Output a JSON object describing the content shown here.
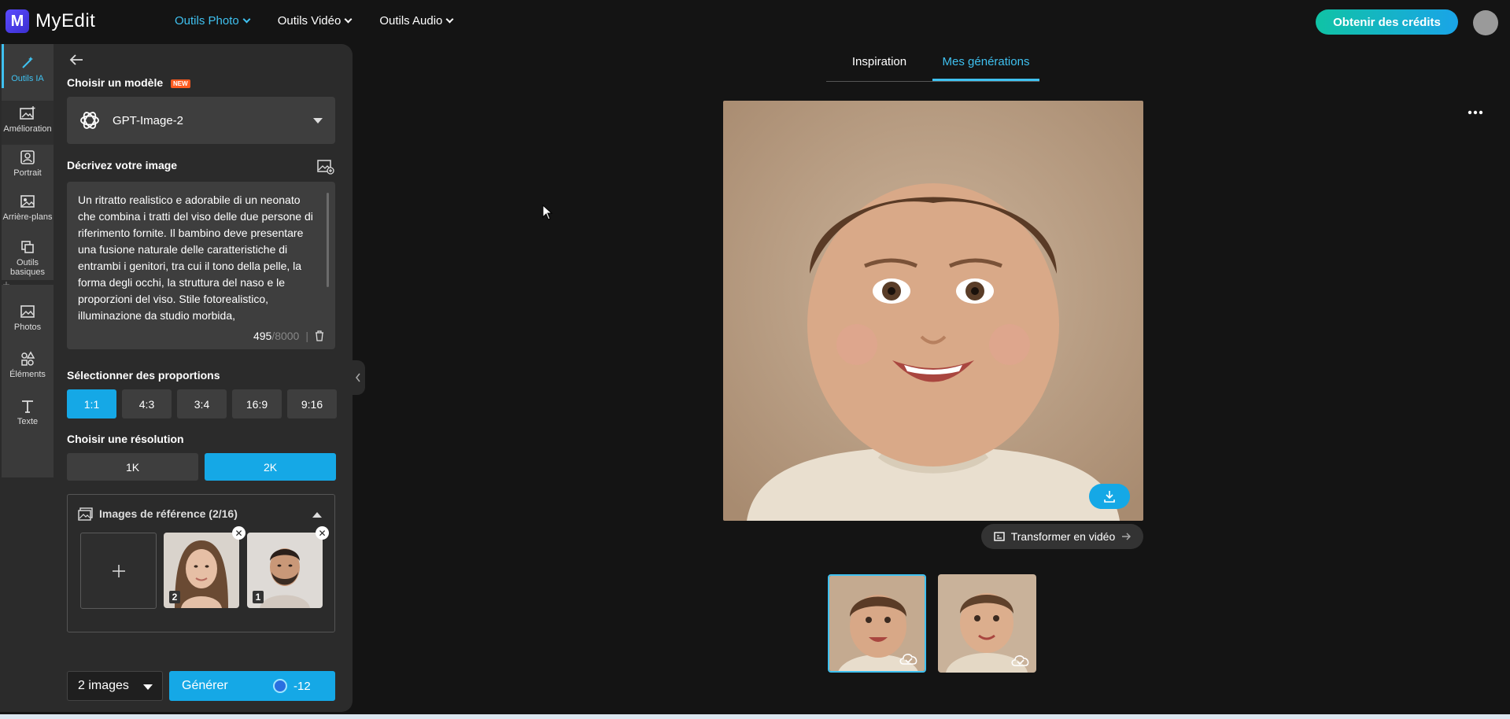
{
  "brand": {
    "name": "MyEdit",
    "mark": "M"
  },
  "nav": {
    "photo_tools": "Outils Photo",
    "video_tools": "Outils Vidéo",
    "audio_tools": "Outils Audio"
  },
  "header": {
    "credits_button": "Obtenir des crédits"
  },
  "rail": {
    "ai_tools": "Outils IA",
    "enhance": "Amélioration",
    "portrait": "Portrait",
    "backgrounds": "Arrière-plans",
    "basic_tools": "Outils basiques",
    "photos": "Photos",
    "elements": "Éléments",
    "text": "Texte"
  },
  "panel": {
    "model_label": "Choisir un modèle",
    "new_badge": "NEW",
    "model_value": "GPT-Image-2",
    "describe_label": "Décrivez votre image",
    "prompt": "Un ritratto realistico e adorabile di un neonato che combina i tratti del viso delle due persone di riferimento fornite. Il bambino deve presentare una fusione naturale delle caratteristiche di entrambi i genitori, tra cui il tono della pelle, la forma degli occhi, la struttura del naso e le proporzioni del viso. Stile fotorealistico, illuminazione da studio morbida,",
    "char_count": "495",
    "char_max": "/8000",
    "ratio_label": "Sélectionner des proportions",
    "ratios": [
      "1:1",
      "4:3",
      "3:4",
      "16:9",
      "9:16"
    ],
    "ratio_selected": "1:1",
    "resolution_label": "Choisir une résolution",
    "resolutions": [
      "1K",
      "2K"
    ],
    "resolution_selected": "2K",
    "references_label": "Images de référence (2/16)",
    "reference_numbers": [
      "2",
      "1"
    ],
    "image_count": "2 images",
    "generate_label": "Générer",
    "generate_cost": "-12"
  },
  "main": {
    "tabs": [
      "Inspiration",
      "Mes générations"
    ],
    "active_tab": "Mes générations",
    "video_button": "Transformer en vidéo",
    "thumbnails_count": 2
  },
  "colors": {
    "accent": "#15a8e6",
    "accent_text": "#3fc1f0",
    "panel": "#2b2b2b",
    "background": "#141414"
  }
}
